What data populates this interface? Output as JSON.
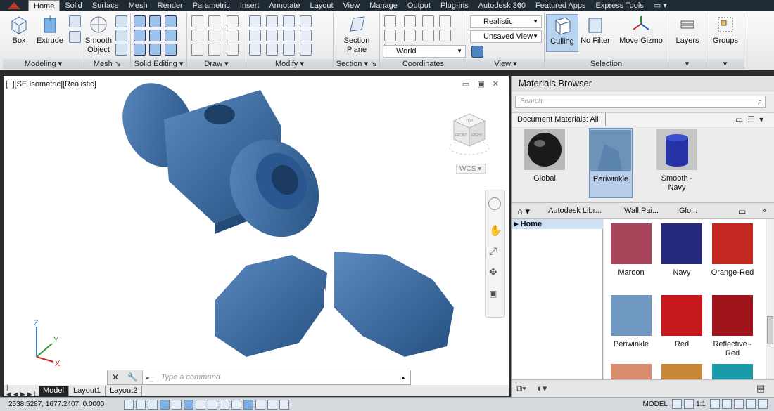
{
  "menu": {
    "tabs": [
      "Home",
      "Solid",
      "Surface",
      "Mesh",
      "Render",
      "Parametric",
      "Insert",
      "Annotate",
      "Layout",
      "View",
      "Manage",
      "Output",
      "Plug-ins",
      "Autodesk 360",
      "Featured Apps",
      "Express Tools"
    ],
    "active": "Home",
    "extra": "▭ ▾"
  },
  "ribbon": {
    "panels": [
      {
        "title": "Modeling ▾",
        "big": [
          "Box",
          "Extrude",
          "Smooth Object"
        ]
      },
      {
        "title": "Mesh ↘"
      },
      {
        "title": "Solid Editing ▾"
      },
      {
        "title": "Draw ▾"
      },
      {
        "title": "Modify ▾"
      },
      {
        "title": "Section ▾  ↘",
        "big": [
          "Section Plane"
        ]
      },
      {
        "title": "Coordinates"
      },
      {
        "title": "View ▾"
      },
      {
        "title": "Selection",
        "big": [
          "Culling",
          "No Filter",
          "Move Gizmo"
        ]
      },
      {
        "title": "▾",
        "big": [
          "Layers"
        ]
      },
      {
        "title": "▾",
        "big": [
          "Groups"
        ]
      }
    ],
    "visual_style": "Realistic",
    "named_view": "Unsaved View",
    "ucs": "World"
  },
  "viewport": {
    "label": "[−][SE Isometric][Realistic]",
    "cube_faces": [
      "TOP",
      "FRONT",
      "RIGHT"
    ],
    "wcs_label": "WCS ▾",
    "ucs_axes": [
      "Z",
      "Y",
      "X"
    ],
    "command_placeholder": "Type a command",
    "cmd_buttons": [
      "✕",
      "🔧",
      "▸_"
    ]
  },
  "layout_tabs": [
    "Model",
    "Layout1",
    "Layout2"
  ],
  "status": {
    "coords": "2538.5287, 1677.2407, 0.0000",
    "model": "MODEL",
    "scale": "1:1"
  },
  "materials": {
    "title": "Materials Browser",
    "search_placeholder": "Search",
    "doc_materials_label": "Document Materials: All",
    "doc_items": [
      {
        "name": "Global",
        "color": "#1a1a1a"
      },
      {
        "name": "Periwinkle",
        "color": "#6d93b7"
      },
      {
        "name": "Smooth - Navy",
        "color": "#2633a7"
      }
    ],
    "library_crumbs": [
      "Autodesk Libr...",
      "Wall Pai...",
      "Glo..."
    ],
    "tree_root": "Home",
    "library_items": [
      {
        "name": "Maroon",
        "color": "#a8455a"
      },
      {
        "name": "Navy",
        "color": "#26297b"
      },
      {
        "name": "Orange-Red",
        "color": "#c32820"
      },
      {
        "name": "Periwinkle",
        "color": "#6e98c2"
      },
      {
        "name": "Red",
        "color": "#c4181c"
      },
      {
        "name": "Reflective - Red",
        "color": "#9f151a"
      },
      {
        "name": "",
        "color": "#d98c6d"
      },
      {
        "name": "",
        "color": "#c98838"
      },
      {
        "name": "",
        "color": "#1b9aa9"
      }
    ]
  },
  "colors": {
    "accent": "#1f2a33",
    "part_blue": "#3c6fa2",
    "select": "#b7cdea"
  }
}
